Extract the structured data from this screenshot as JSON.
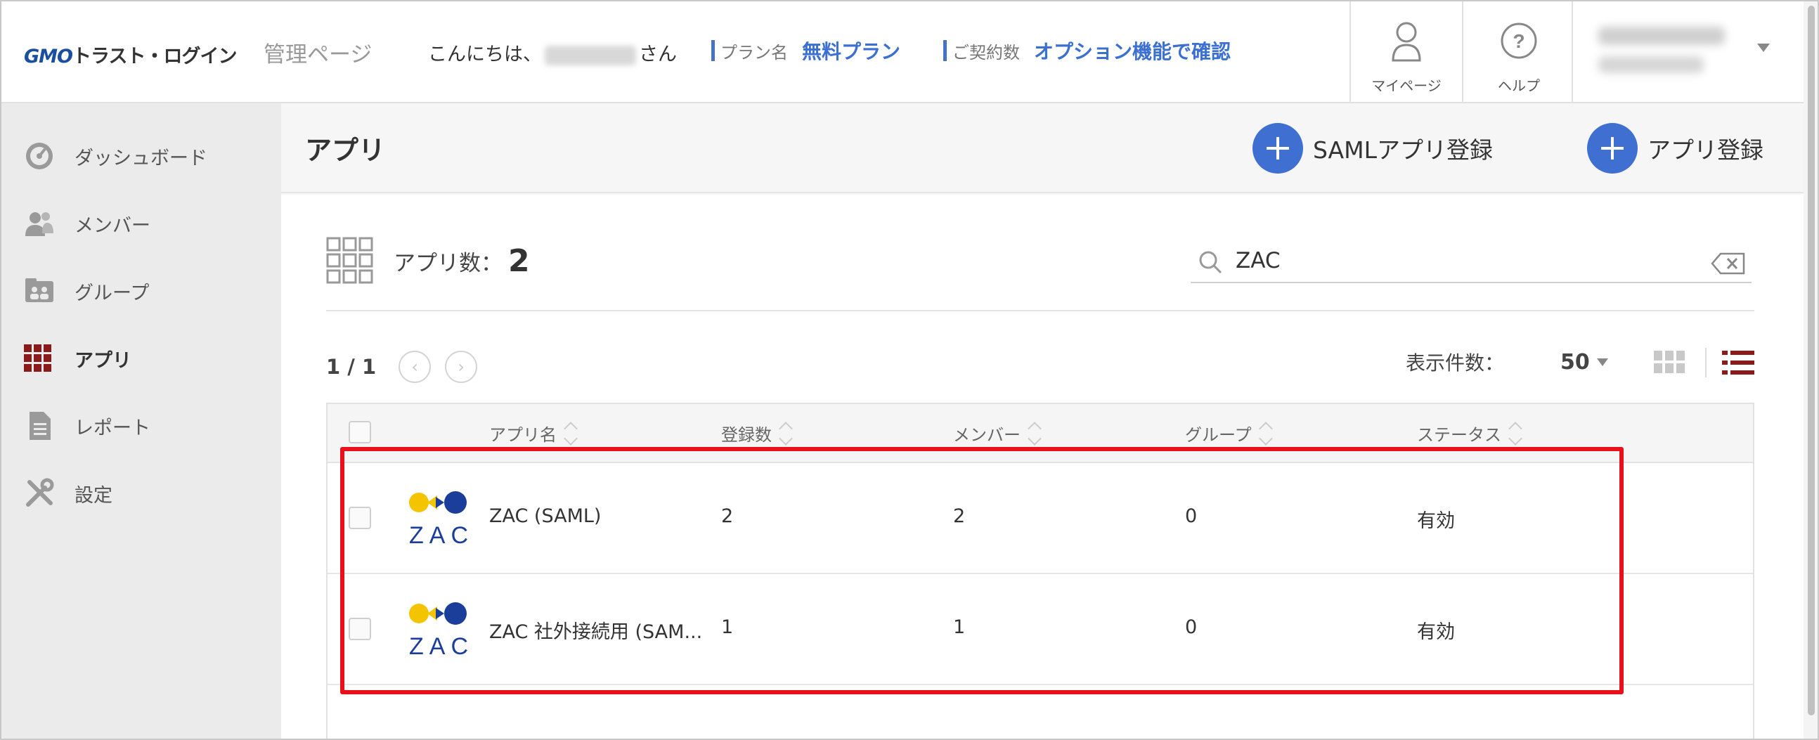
{
  "header": {
    "logo_gmo": "GMO",
    "logo_rest": "トラスト・ログイン",
    "title": "管理ページ",
    "greeting_prefix": "こんにちは、",
    "greeting_suffix": "さん",
    "plan_label": "プラン名",
    "plan_value": "無料プラン",
    "contracts_label": "ご契約数",
    "contracts_value": "オプション機能で確認",
    "mypage_label": "マイページ",
    "help_label": "ヘルプ"
  },
  "sidebar": {
    "items": [
      {
        "label": "ダッシュボード",
        "icon": "dashboard-icon"
      },
      {
        "label": "メンバー",
        "icon": "members-icon"
      },
      {
        "label": "グループ",
        "icon": "group-icon"
      },
      {
        "label": "アプリ",
        "icon": "apps-grid-icon",
        "active": true
      },
      {
        "label": "レポート",
        "icon": "report-icon"
      },
      {
        "label": "設定",
        "icon": "settings-tools-icon"
      }
    ]
  },
  "page": {
    "title": "アプリ",
    "saml_add_label": "SAMLアプリ登録",
    "app_add_label": "アプリ登録"
  },
  "summary": {
    "count_label": "アプリ数：",
    "count_value": "2"
  },
  "search": {
    "value": "ZAC"
  },
  "pagination": {
    "page": "1 / 1",
    "per_page_label": "表示件数：",
    "per_page_value": "50"
  },
  "table": {
    "headers": [
      "アプリ名",
      "登録数",
      "メンバー",
      "グループ",
      "ステータス"
    ],
    "rows": [
      {
        "name": "ZAC (SAML)",
        "registered": "2",
        "members": "2",
        "groups": "0",
        "status": "有効"
      },
      {
        "name": "ZAC 社外接続用 (SAM...",
        "registered": "1",
        "members": "1",
        "groups": "0",
        "status": "有効"
      }
    ]
  },
  "colors": {
    "accent": "#3f6fd0",
    "active_nav": "#8b1a1a",
    "highlight": "#e8101a",
    "zac_yellow": "#f5c400",
    "zac_blue": "#1a3e9a"
  }
}
